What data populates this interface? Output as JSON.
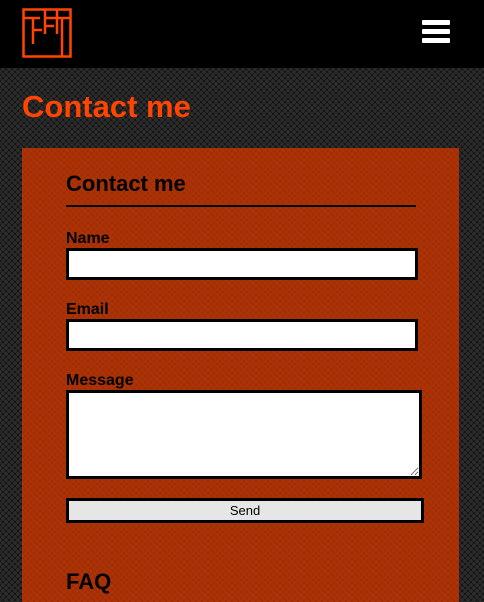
{
  "header": {
    "logo_icon": "ff-monogram-logo",
    "menu_icon": "hamburger-menu-icon",
    "accent_color": "#ff4500"
  },
  "page": {
    "title": "Contact me"
  },
  "form": {
    "title": "Contact me",
    "name_label": "Name",
    "name_value": "",
    "email_label": "Email",
    "email_value": "",
    "message_label": "Message",
    "message_value": "",
    "send_label": "Send"
  },
  "faq": {
    "title": "FAQ"
  }
}
